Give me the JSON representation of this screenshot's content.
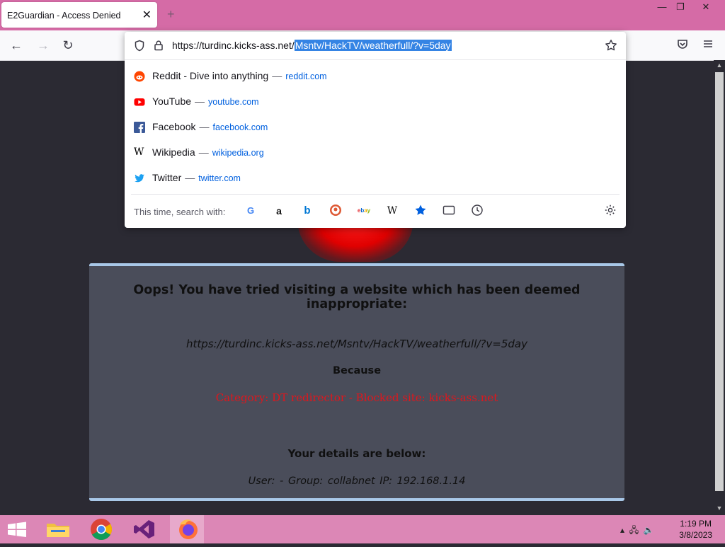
{
  "window": {
    "tab_title": "E2Guardian - Access Denied",
    "tab_close": "✕",
    "new_tab": "+",
    "minimize": "—",
    "restore": "❐",
    "close": "✕"
  },
  "navbar": {
    "back": "←",
    "forward": "→",
    "reload": "↻"
  },
  "urlbar": {
    "url_prefix": "https://turdinc.kicks-ass.net/",
    "url_selected": "Msntv/HackTV/weatherfull/?v=5day",
    "suggestions": [
      {
        "title": "Reddit - Dive into anything",
        "url": "reddit.com",
        "icon": "reddit-icon",
        "color": "#ff4500"
      },
      {
        "title": "YouTube",
        "url": "youtube.com",
        "icon": "youtube-icon",
        "color": "#ff0000"
      },
      {
        "title": "Facebook",
        "url": "facebook.com",
        "icon": "facebook-icon",
        "color": "#3b5998"
      },
      {
        "title": "Wikipedia",
        "url": "wikipedia.org",
        "icon": "wikipedia-icon",
        "color": "#000000"
      },
      {
        "title": "Twitter",
        "url": "twitter.com",
        "icon": "twitter-icon",
        "color": "#1da1f2"
      }
    ],
    "separator": "—",
    "search_with_label": "This time, search with:",
    "engines": [
      "google",
      "amazon",
      "bing",
      "duckduckgo",
      "ebay",
      "wikipedia",
      "bookmarks",
      "tabs",
      "history"
    ]
  },
  "page": {
    "heading": "Oops! You have tried visiting a website which has been deemed inappropriate:",
    "blocked_url": "https://turdinc.kicks-ass.net/Msntv/HackTV/weatherfull/?v=5day",
    "because": "Because",
    "reason": "Category: DT redirector - Blocked site: kicks-ass.net",
    "details_label": "Your details are below:",
    "details": "User: -   Group: collabnet   IP: 192.168.1.14",
    "accent_color": "#a9c8e8",
    "reason_color": "#e0161c"
  },
  "taskbar": {
    "time": "1:19 PM",
    "date": "3/8/2023",
    "apps": [
      "start",
      "file-explorer",
      "chrome",
      "visual-studio",
      "firefox"
    ]
  }
}
